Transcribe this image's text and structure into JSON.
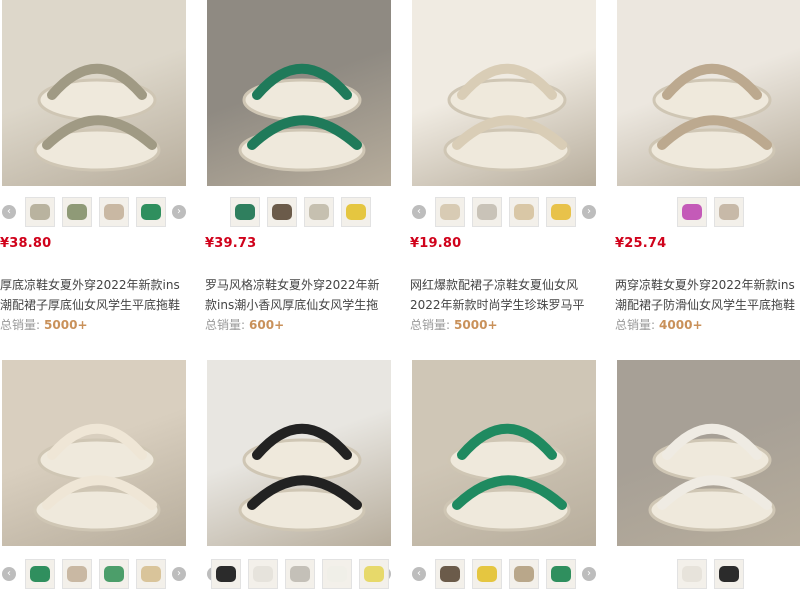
{
  "colors": {
    "price": "#d0021b",
    "sales_count": "#c9915a",
    "text": "#444444",
    "muted": "#999999"
  },
  "products": [
    {
      "price": "¥38.80",
      "title_line1": "厚底凉鞋女夏外穿2022年新款ins",
      "title_line2": "潮配裙子厚底仙女风学生平底拖鞋",
      "sales_label": "总销量:",
      "sales_count": "5000+",
      "main_colors": [
        "#ddd7ca",
        "#a09a84"
      ],
      "thumbs": [
        "#b9b39f",
        "#8f9a77",
        "#c9b8a3",
        "#2f8f5e"
      ]
    },
    {
      "price": "¥39.73",
      "title_line1": "罗马风格凉鞋女夏外穿2022年新",
      "title_line2": "款ins潮小香风厚底仙女风学生拖",
      "sales_label": "总销量:",
      "sales_count": "600+",
      "main_colors": [
        "#8f8a82",
        "#1f7a5a"
      ],
      "thumbs": [
        "#2f7f5e",
        "#6b5b4a",
        "#c6c0b0",
        "#e5c640"
      ]
    },
    {
      "price": "¥19.80",
      "title_line1": "网红爆款配裙子凉鞋女夏仙女风",
      "title_line2": "2022年新款时尚学生珍珠罗马平",
      "sales_label": "总销量:",
      "sales_count": "5000+",
      "main_colors": [
        "#f0ebe2",
        "#d9cdb6"
      ],
      "thumbs": [
        "#d8cbb4",
        "#c9c3b8",
        "#d9c7a6",
        "#e8c24a"
      ]
    },
    {
      "price": "¥25.74",
      "title_line1": "两穿凉鞋女夏外穿2022年新款ins",
      "title_line2": "潮配裙子防滑仙女风学生平底拖鞋",
      "sales_label": "总销量:",
      "sales_count": "4000+",
      "main_colors": [
        "#ece7df",
        "#bca98f"
      ],
      "thumbs": [
        "#c45ab8",
        "#c7b9a8"
      ]
    },
    {
      "main_colors": [
        "#d9cfbf",
        "#efe6d6"
      ],
      "thumbs": [
        "#2f8f5e",
        "#c9b8a3",
        "#4c9e6a",
        "#d9c49a"
      ]
    },
    {
      "main_colors": [
        "#e8e6e1",
        "#222222"
      ],
      "thumbs": [
        "#2b2b2b",
        "#e6e3dc",
        "#c4c0b8",
        "#f0efe8",
        "#e7d96a"
      ]
    },
    {
      "main_colors": [
        "#cfc6b6",
        "#1f8a60"
      ],
      "thumbs": [
        "#6b5b4a",
        "#e5c640",
        "#b9a78a",
        "#2f8f5e"
      ]
    },
    {
      "main_colors": [
        "#a7a096",
        "#efebe3"
      ],
      "thumbs": [
        "#e7e3db",
        "#2b2b2b"
      ]
    }
  ]
}
